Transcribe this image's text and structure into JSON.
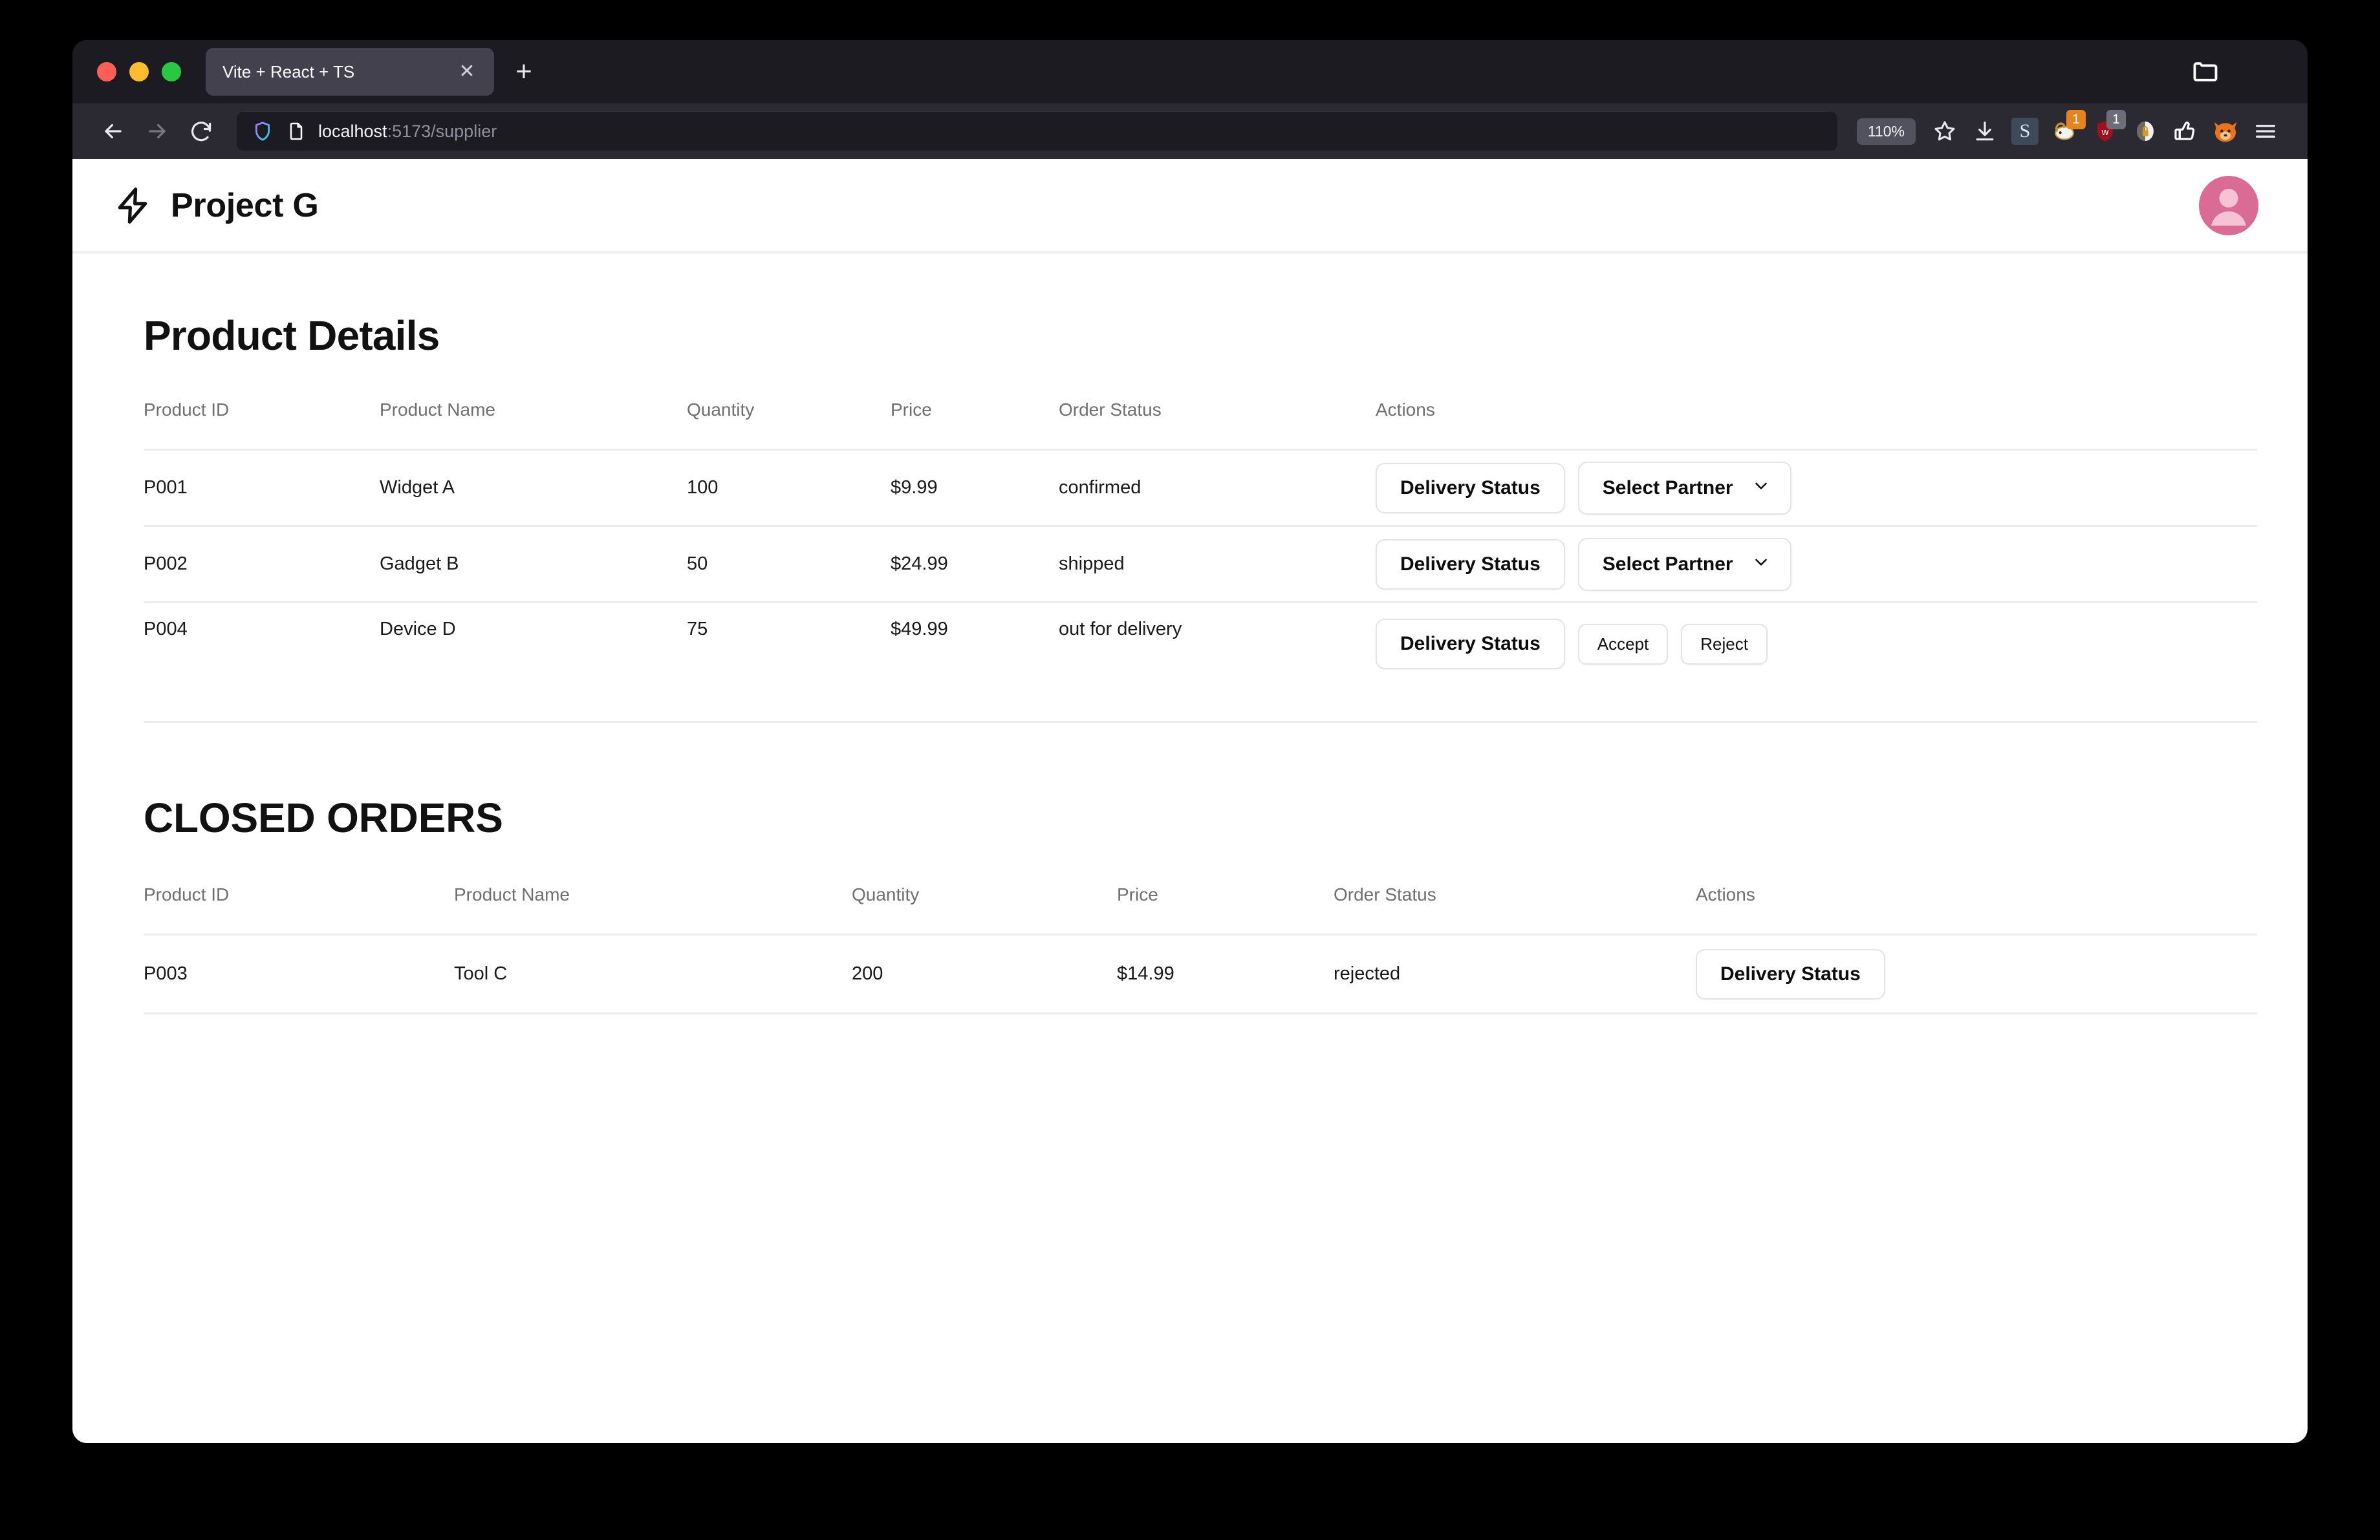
{
  "browser": {
    "tab": {
      "title": "Vite + React + TS",
      "close_label": "✕"
    },
    "new_tab_label": "+",
    "url": {
      "host": "localhost",
      "path": ":5173/supplier"
    },
    "zoom_level": "110%",
    "extension_badges": {
      "one": "1",
      "two": "1"
    },
    "icons": {
      "back": "back-arrow-icon",
      "forward": "forward-arrow-icon",
      "reload": "reload-icon",
      "shield": "shield-icon",
      "page": "page-icon",
      "bookmark": "star-icon",
      "downloads": "download-icon",
      "menu": "hamburger-menu-icon",
      "tab_list": "tab-list-icon"
    }
  },
  "app": {
    "brand": "Project G",
    "logo": "lightning-bolt-icon",
    "avatar": "user-avatar-icon"
  },
  "main": {
    "page_title": "Product Details",
    "orders_table": {
      "columns": [
        "Product ID",
        "Product Name",
        "Quantity",
        "Price",
        "Order Status",
        "Actions"
      ],
      "rows": [
        {
          "product_id": "P001",
          "product_name": "Widget A",
          "quantity": "100",
          "price": "$9.99",
          "order_status": "confirmed",
          "actions": {
            "delivery": "Delivery Status",
            "partner": "Select Partner"
          }
        },
        {
          "product_id": "P002",
          "product_name": "Gadget B",
          "quantity": "50",
          "price": "$24.99",
          "order_status": "shipped",
          "actions": {
            "delivery": "Delivery Status",
            "partner": "Select Partner"
          }
        },
        {
          "product_id": "P004",
          "product_name": "Device D",
          "quantity": "75",
          "price": "$49.99",
          "order_status": "out for delivery",
          "actions": {
            "delivery": "Delivery Status",
            "accept": "Accept",
            "reject": "Reject"
          }
        }
      ]
    },
    "closed_orders": {
      "title": "CLOSED ORDERS",
      "columns": [
        "Product ID",
        "Product Name",
        "Quantity",
        "Price",
        "Order Status",
        "Actions"
      ],
      "rows": [
        {
          "product_id": "P003",
          "product_name": "Tool C",
          "quantity": "200",
          "price": "$14.99",
          "order_status": "rejected",
          "actions": {
            "delivery": "Delivery Status"
          }
        }
      ]
    }
  },
  "colors": {
    "avatar": "#d96b94",
    "browser_chrome": "#1c1b22",
    "nav_bar": "#2b2a33",
    "tab_active": "#42414d",
    "page_bg": "#ffffff",
    "border": "#ececec",
    "muted_text": "#6f6f6f"
  }
}
